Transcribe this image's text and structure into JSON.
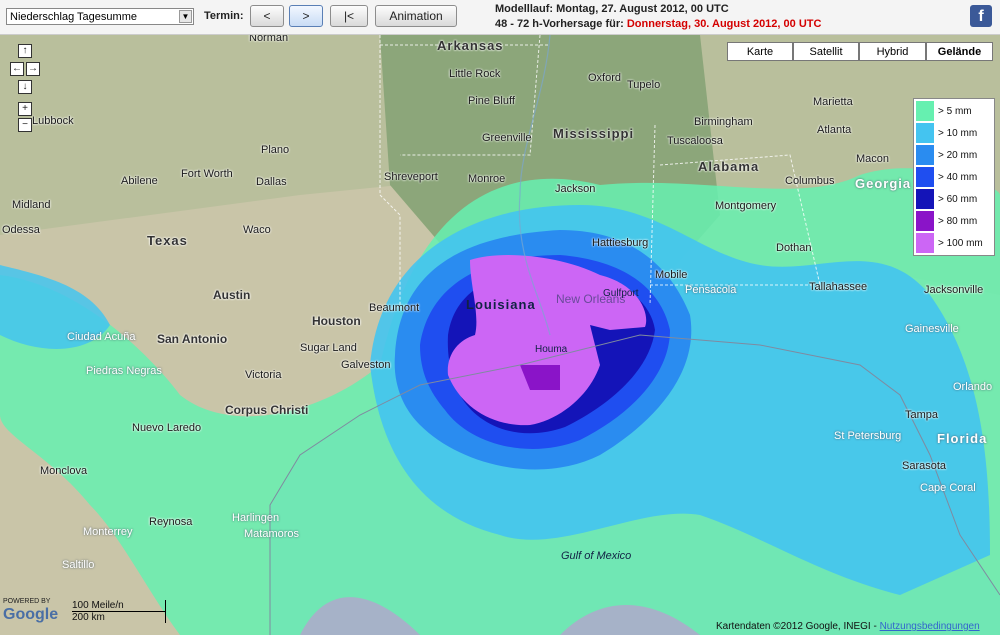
{
  "toolbar": {
    "product_select": "Niederschlag Tagesumme",
    "termin_label": "Termin:",
    "prev_label": "<",
    "next_label": ">",
    "first_label": "|<",
    "animation_label": "Animation"
  },
  "info": {
    "line1": "Modelllauf: Montag, 27. August 2012, 00 UTC",
    "line2_prefix": "48 - 72 h-Vorhersage für: ",
    "line2_date": "Donnerstag, 30. August 2012, 00 UTC"
  },
  "facebook_icon": "facebook-icon",
  "map_types": [
    "Karte",
    "Satellit",
    "Hybrid",
    "Gelände"
  ],
  "legend": [
    {
      "label": "> 5 mm",
      "color": "#66f0b0"
    },
    {
      "label": "> 10 mm",
      "color": "#44c4f0"
    },
    {
      "label": "> 20 mm",
      "color": "#2a8cf0"
    },
    {
      "label": "> 40 mm",
      "color": "#1f4ef0"
    },
    {
      "label": "> 60 mm",
      "color": "#1414b8"
    },
    {
      "label": "> 80 mm",
      "color": "#8a14c8"
    },
    {
      "label": "> 100 mm",
      "color": "#cc66f5"
    }
  ],
  "map_labels": {
    "states": [
      "Arkansas",
      "Mississippi",
      "Alabama",
      "Georgia",
      "Texas",
      "Louisiana",
      "Florida"
    ],
    "cities": [
      "Norman",
      "Little Rock",
      "Oxford",
      "Tupelo",
      "Pine Bluff",
      "Greenville",
      "Birmingham",
      "Tuscaloosa",
      "Atlanta",
      "Marietta",
      "Macon",
      "Columbus",
      "Montgomery",
      "Dothan",
      "Plano",
      "Fort Worth",
      "Dallas",
      "Abilene",
      "Shreveport",
      "Monroe",
      "Jackson",
      "Hattiesburg",
      "Midland",
      "Odessa",
      "Waco",
      "Austin",
      "Houston",
      "Beaumont",
      "Mobile",
      "Pensacola",
      "Tallahassee",
      "Jacksonville",
      "Gainesville",
      "Orlando",
      "Tampa",
      "St Petersburg",
      "Sarasota",
      "Cape Coral",
      "San Antonio",
      "Sugar Land",
      "Galveston",
      "Victoria",
      "Corpus Christi",
      "Nuevo Laredo",
      "Monclova",
      "Reynosa",
      "Harlingen",
      "Matamoros",
      "Monterrey",
      "Saltillo",
      "Ciudad Acuña",
      "Piedras Negras",
      "New Orleans",
      "Houma",
      "Gulfport",
      "Gulf of Mexico",
      "Lubbock"
    ]
  },
  "scale": {
    "miles": "100 Meile/n",
    "km": "200 km"
  },
  "attribution": {
    "text": "Kartendaten ©2012 Google, INEGI - ",
    "link": "Nutzungsbedingungen"
  },
  "google_logo": {
    "powered": "POWERED BY",
    "name": "Google"
  }
}
